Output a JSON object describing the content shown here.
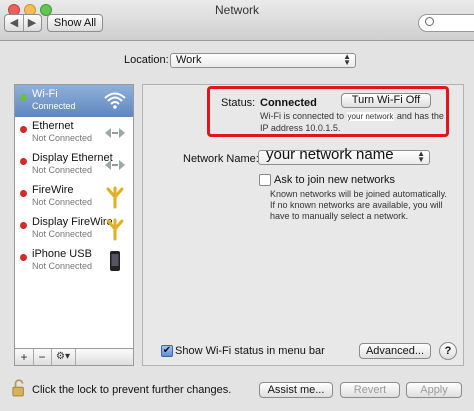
{
  "window": {
    "title": "Network"
  },
  "toolbar": {
    "back_glyph": "◀",
    "forward_glyph": "▶",
    "show_all_label": "Show All",
    "search_placeholder": ""
  },
  "location": {
    "label": "Location:",
    "value": "Work"
  },
  "sidebar": {
    "items": [
      {
        "name": "Wi-Fi",
        "status": "Connected",
        "status_color": "#6bbf3a",
        "icon": "wifi-icon",
        "selected": true
      },
      {
        "name": "Ethernet",
        "status": "Not Connected",
        "status_color": "#d6272a",
        "icon": "ethernet-icon",
        "selected": false
      },
      {
        "name": "Display Ethernet",
        "status": "Not Connected",
        "status_color": "#d6272a",
        "icon": "ethernet-icon",
        "selected": false
      },
      {
        "name": "FireWire",
        "status": "Not Connected",
        "status_color": "#d6272a",
        "icon": "firewire-icon",
        "selected": false
      },
      {
        "name": "Display FireWire",
        "status": "Not Connected",
        "status_color": "#d6272a",
        "icon": "firewire-icon",
        "selected": false
      },
      {
        "name": "iPhone USB",
        "status": "Not Connected",
        "status_color": "#d6272a",
        "icon": "iphone-icon",
        "selected": false
      }
    ],
    "add_glyph": "+",
    "remove_glyph": "−",
    "action_glyph": "⚙▾"
  },
  "status": {
    "label": "Status:",
    "value": "Connected",
    "turn_off_label": "Turn Wi-Fi Off",
    "desc_prefix": "Wi-Fi is connected to",
    "network_overlay": "your network",
    "desc_suffix": "and has the",
    "ip_line": "IP address 10.0.1.5."
  },
  "network_name": {
    "label": "Network Name:",
    "value": "your network name"
  },
  "ask_join": {
    "label": "Ask to join new networks",
    "desc_lines": [
      "Known networks will be joined automatically.",
      "If no known networks are available, you will",
      "have to manually select a network."
    ],
    "checked": false
  },
  "show_status": {
    "label": "Show Wi-Fi status in menu bar",
    "checked": true
  },
  "buttons": {
    "advanced": "Advanced...",
    "help": "?",
    "assist": "Assist me...",
    "revert": "Revert",
    "apply": "Apply"
  },
  "lock": {
    "text": "Click the lock to prevent further changes."
  }
}
